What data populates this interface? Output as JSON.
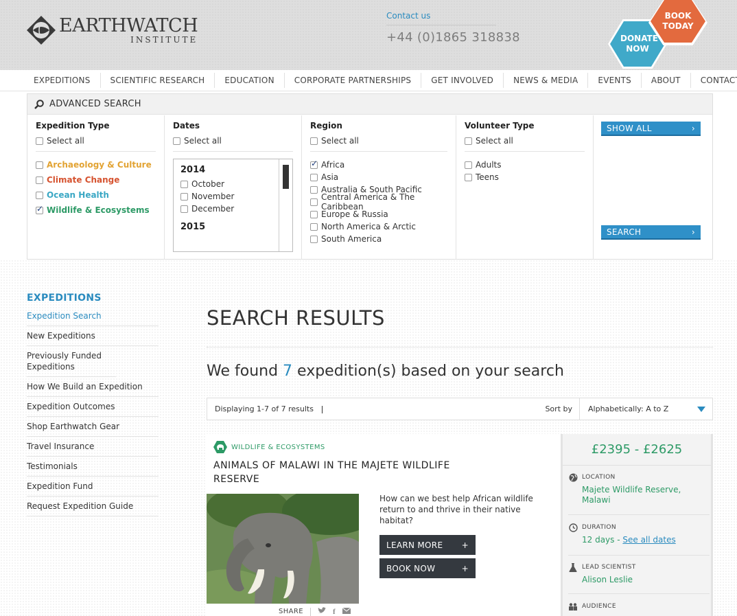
{
  "header": {
    "logo_main": "EARTHWATCH",
    "logo_sub": "INSTITUTE",
    "contact_link": "Contact us",
    "phone": "+44 (0)1865 318838",
    "book_btn": "BOOK TODAY",
    "donate_btn": "DONATE NOW"
  },
  "nav": [
    "EXPEDITIONS",
    "SCIENTIFIC RESEARCH",
    "EDUCATION",
    "CORPORATE PARTNERSHIPS",
    "GET INVOLVED",
    "NEWS & MEDIA",
    "EVENTS",
    "ABOUT",
    "CONTACT"
  ],
  "advanced_search": {
    "title": "ADVANCED SEARCH",
    "expedition_type": {
      "title": "Expedition Type",
      "select_all": "Select all",
      "items": [
        {
          "label": "Archaeology & Culture",
          "checked": false,
          "color": "#e2a333"
        },
        {
          "label": "Climate Change",
          "checked": false,
          "color": "#d65330"
        },
        {
          "label": "Ocean Health",
          "checked": false,
          "color": "#3aa7c4"
        },
        {
          "label": "Wildlife & Ecosystems",
          "checked": true,
          "color": "#2d9a66"
        }
      ]
    },
    "dates": {
      "title": "Dates",
      "select_all": "Select all",
      "year1": "2014",
      "months1": [
        "October",
        "November",
        "December"
      ],
      "year2": "2015"
    },
    "region": {
      "title": "Region",
      "select_all": "Select all",
      "items": [
        {
          "label": "Africa",
          "checked": true
        },
        {
          "label": "Asia",
          "checked": false
        },
        {
          "label": "Australia & South Pacific",
          "checked": false
        },
        {
          "label": "Central America & The Caribbean",
          "checked": false
        },
        {
          "label": "Europe & Russia",
          "checked": false
        },
        {
          "label": "North America & Arctic",
          "checked": false
        },
        {
          "label": "South America",
          "checked": false
        }
      ]
    },
    "volunteer_type": {
      "title": "Volunteer Type",
      "select_all": "Select all",
      "items": [
        {
          "label": "Adults",
          "checked": false
        },
        {
          "label": "Teens",
          "checked": false
        }
      ]
    },
    "show_all": "SHOW ALL",
    "search": "SEARCH"
  },
  "sidebar": {
    "title": "EXPEDITIONS",
    "items": [
      {
        "label": "Expedition Search",
        "active": true
      },
      {
        "label": "New Expeditions",
        "active": false
      },
      {
        "label": "Previously Funded Expeditions",
        "active": false
      },
      {
        "label": "How We Build an Expedition",
        "active": false
      },
      {
        "label": "Expedition Outcomes",
        "active": false
      },
      {
        "label": "Shop Earthwatch Gear",
        "active": false
      },
      {
        "label": "Travel Insurance",
        "active": false
      },
      {
        "label": "Testimonials",
        "active": false
      },
      {
        "label": "Expedition Fund",
        "active": false
      },
      {
        "label": "Request Expedition Guide",
        "active": false
      }
    ]
  },
  "results": {
    "title": "SEARCH RESULTS",
    "found_pre": "We found ",
    "found_count": "7",
    "found_post": " expedition(s) based on your search",
    "displaying": "Displaying 1-7 of 7 results",
    "sort_label": "Sort by",
    "sort_value": "Alphabetically: A to Z"
  },
  "card": {
    "category": "WILDLIFE & ECOSYSTEMS",
    "title": "ANIMALS OF MALAWI IN THE MAJETE WILDLIFE RESERVE",
    "description": "How can we best help African wildlife return to and thrive in their native habitat?",
    "learn_more": "LEARN MORE",
    "book_now": "BOOK NOW",
    "share": "SHARE",
    "price": "£2395 - £2625",
    "location_label": "LOCATION",
    "location": "Majete Wildlife Reserve, Malawi",
    "duration_label": "DURATION",
    "duration": "12 days - ",
    "duration_link": "See all dates",
    "scientist_label": "LEAD SCIENTIST",
    "scientist": "Alison Leslie",
    "audience_label": "AUDIENCE"
  },
  "colors": {
    "accent_blue": "#2a8bbf",
    "green": "#2d9a66",
    "orange": "#e36a3e",
    "teal": "#40a9c9"
  }
}
